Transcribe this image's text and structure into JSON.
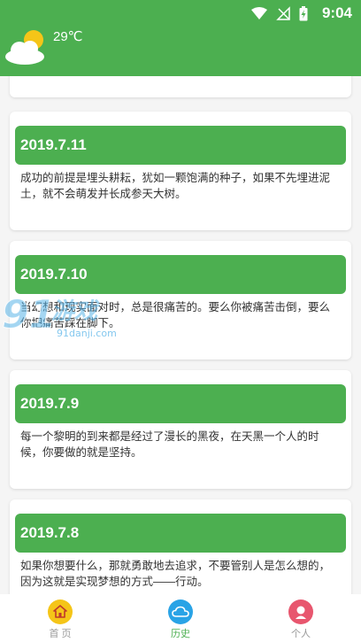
{
  "status": {
    "time": "9:04"
  },
  "weather": {
    "temperature": "29℃",
    "icon": "cloud-sun-icon"
  },
  "cards": [
    {
      "date": "2019.7.11",
      "text": "成功的前提是埋头耕耘，犹如一颗饱满的种子，如果不先埋进泥土，就不会萌发并长成参天大树。"
    },
    {
      "date": "2019.7.10",
      "text": "当幻想和现实面对时，总是很痛苦的。要么你被痛苦击倒，要么你把痛苦踩在脚下。"
    },
    {
      "date": "2019.7.9",
      "text": "每一个黎明的到来都是经过了漫长的黑夜，在天黑一个人的时候，你要做的就是坚持。"
    },
    {
      "date": "2019.7.8",
      "text": "如果你想要什么，那就勇敢地去追求，不要管别人是怎么想的，因为这就是实现梦想的方式——行动。"
    }
  ],
  "watermark": {
    "text": "91danji.com"
  },
  "tabs": [
    {
      "label": "首 页",
      "icon": "home-icon",
      "color": "#f5c518"
    },
    {
      "label": "历史",
      "icon": "cloud-icon",
      "color": "#29a3e6",
      "active": true
    },
    {
      "label": "个人",
      "icon": "person-icon",
      "color": "#e8566e"
    }
  ],
  "colors": {
    "accent": "#4caf50"
  }
}
